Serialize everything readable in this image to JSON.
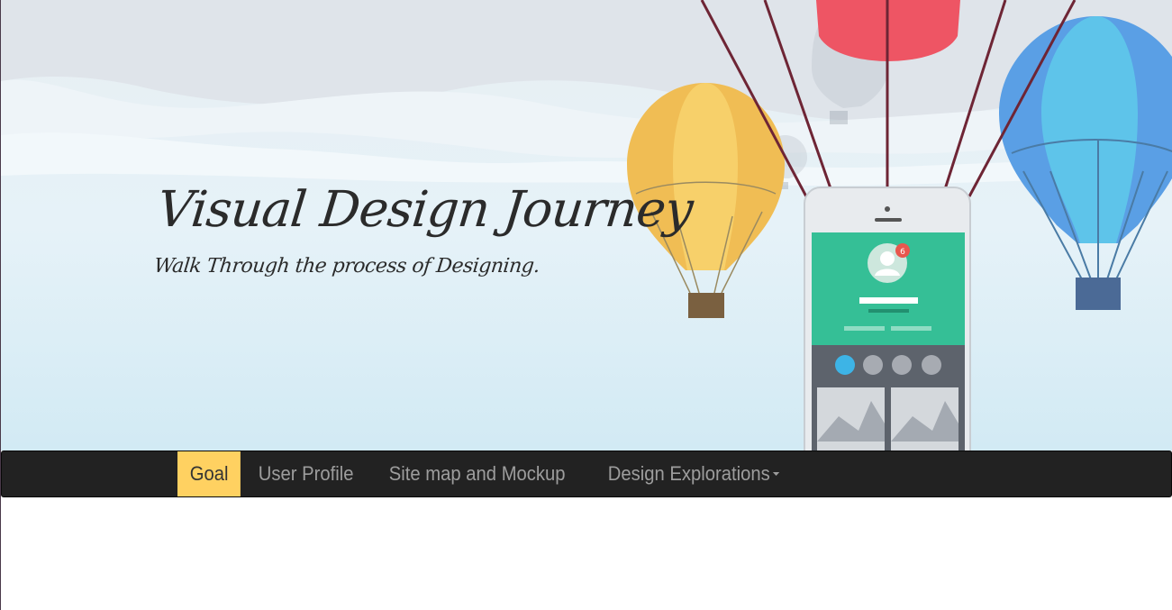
{
  "hero": {
    "title": "Visual Design Journey",
    "subtitle": "Walk Through the process of Designing."
  },
  "nav": {
    "items": [
      {
        "label": "Goal",
        "active": true
      },
      {
        "label": "User Profile"
      },
      {
        "label": "Site map and Mockup"
      },
      {
        "label": "Design Explorations",
        "dropdown": true
      }
    ]
  },
  "phone": {
    "notification_count": "6"
  },
  "colors": {
    "navbar_bg": "#222222",
    "active_tab": "#ffd161",
    "nav_text": "#9d9d9d",
    "hero_text": "#2b2b2b",
    "phone_green": "#35bf96",
    "balloon_yellow": "#f5c75a",
    "balloon_blue": "#5aaee8",
    "balloon_red": "#ee5564"
  }
}
